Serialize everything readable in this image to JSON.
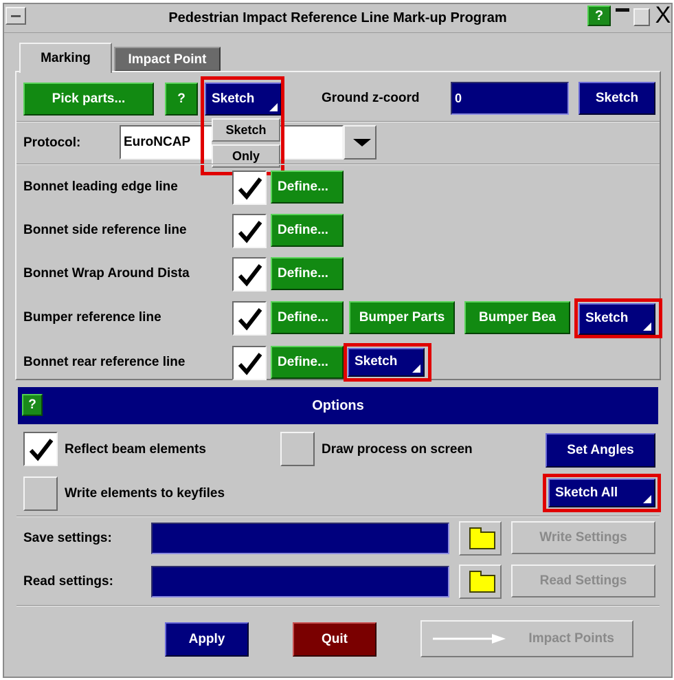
{
  "window": {
    "title": "Pedestrian Impact Reference Line Mark-up Program",
    "help_label": "?",
    "close_label": "X"
  },
  "tabs": [
    {
      "label": "Marking",
      "active": true
    },
    {
      "label": "Impact Point",
      "active": false
    }
  ],
  "toolbar": {
    "pick_parts_label": "Pick parts...",
    "help_label": "?",
    "sketch_menu_label": "Sketch",
    "ground_label": "Ground z-coord",
    "ground_value": "0",
    "ground_sketch_label": "Sketch"
  },
  "sketch_dropdown": {
    "items": [
      "Sketch",
      "Only"
    ]
  },
  "protocol": {
    "label": "Protocol:",
    "value": "EuroNCAP"
  },
  "lines": [
    {
      "label": "Bonnet leading edge line",
      "checked": true,
      "define_label": "Define..."
    },
    {
      "label": "Bonnet side reference line",
      "checked": true,
      "define_label": "Define..."
    },
    {
      "label": "Bonnet Wrap Around Dista",
      "checked": true,
      "define_label": "Define..."
    },
    {
      "label": "Bumper reference line",
      "checked": true,
      "define_label": "Define...",
      "parts_label": "Bumper Parts",
      "beam_label": "Bumper Bea",
      "sketch_label": "Sketch"
    },
    {
      "label": "Bonnet rear reference line",
      "checked": true,
      "define_label": "Define...",
      "sketch_label": "Sketch"
    }
  ],
  "options": {
    "title": "Options",
    "help_label": "?",
    "reflect_label": "Reflect beam elements",
    "reflect_checked": true,
    "draw_label": "Draw process on screen",
    "draw_checked": false,
    "set_angles_label": "Set Angles",
    "write_label": "Write elements to keyfiles",
    "write_checked": false,
    "sketch_all_label": "Sketch All"
  },
  "settings": {
    "save_label": "Save settings:",
    "save_value": "",
    "write_button_label": "Write Settings",
    "read_label": "Read settings:",
    "read_value": "",
    "read_button_label": "Read Settings"
  },
  "footer": {
    "apply_label": "Apply",
    "quit_label": "Quit",
    "impact_points_label": "Impact Points"
  },
  "colors": {
    "panel_bg": "#c6c6c6",
    "button_green": "#128a12",
    "button_blue": "#00007e",
    "button_quit": "#7a0000",
    "highlight_red": "#e00000",
    "folder_yellow": "#ffff00"
  }
}
